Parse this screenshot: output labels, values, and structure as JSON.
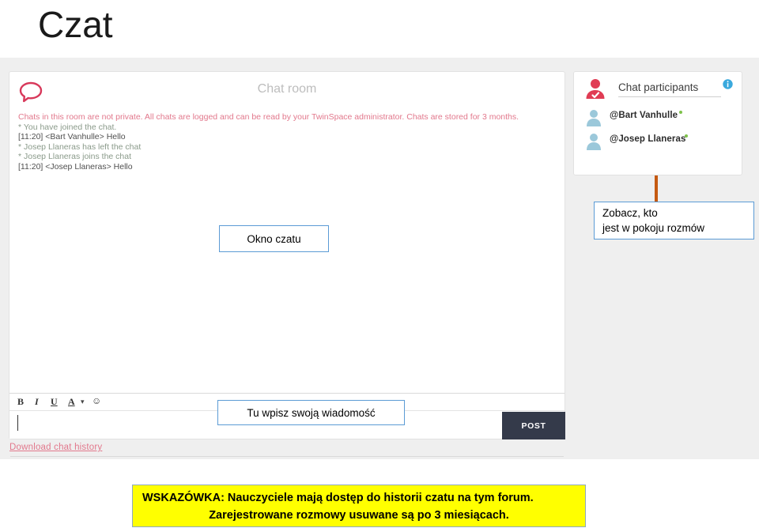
{
  "slide": {
    "title": "Czat"
  },
  "chat_window": {
    "icon": "speech-bubble-icon",
    "room_title": "Chat room",
    "log": [
      {
        "type": "warning",
        "text": "Chats in this room are not private. All chats are logged and can be read by your TwinSpace administrator. Chats are stored for 3 months."
      },
      {
        "type": "system",
        "text": "* You have joined the chat."
      },
      {
        "type": "message",
        "text": "[11:20] <Bart Vanhulle> Hello"
      },
      {
        "type": "system",
        "text": "* Josep Llaneras has left the chat"
      },
      {
        "type": "system",
        "text": "* Josep Llaneras joins the chat"
      },
      {
        "type": "message",
        "text": "[11:20] <Josep Llaneras> Hello"
      }
    ],
    "toolbar": {
      "bold": "B",
      "italic": "I",
      "underline": "U",
      "text_color": "A",
      "text_color_caret": "▾",
      "emoji": "☺"
    },
    "message_input": {
      "value": "",
      "placeholder": ""
    },
    "post_button": "POST",
    "download_link": "Download chat history"
  },
  "participants_panel": {
    "avatar_icon": "user-check-avatar-icon",
    "title": "Chat participants",
    "info_icon": "info-icon",
    "members": [
      {
        "name": "@Bart Vanhulle",
        "status": "online"
      },
      {
        "name": "@Josep Llaneras",
        "status": "online"
      }
    ]
  },
  "annotations": {
    "chat_window_label": "Okno czatu",
    "message_input_label": "Tu wpisz swoją wiadomość",
    "participants_label_line1": "Zobacz, kto",
    "participants_label_line2": "jest w pokoju rozmów"
  },
  "tip": {
    "line1": "WSKAZÓWKA: Nauczyciele mają dostęp do historii czatu na tym forum.",
    "line2": "Zarejestrowane rozmowy usuwane są po 3 miesiącach."
  },
  "colors": {
    "accent_pink": "#e2788c",
    "post_button_bg": "#343a4a",
    "callout_border": "#5b9bd5",
    "connector": "#c55a11",
    "tip_bg": "#ffff00",
    "online_dot": "#7ec24a"
  }
}
